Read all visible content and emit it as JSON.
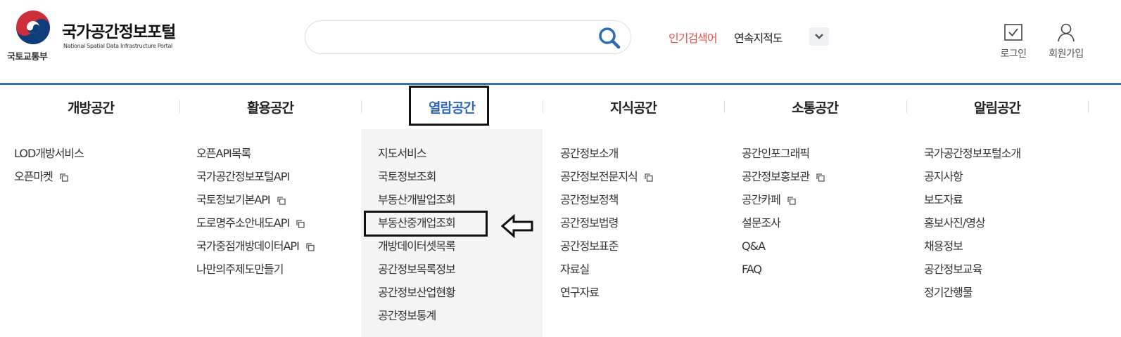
{
  "brand": {
    "ministry": "국토교통부",
    "title": "국가공간정보포털",
    "subtitle": "National Spatial Data Infrastructure Portal"
  },
  "search": {
    "placeholder": "",
    "value": ""
  },
  "popular": {
    "label": "인기검색어",
    "term": "연속지적도"
  },
  "util": {
    "login": "로그인",
    "join": "회원가입"
  },
  "colors": {
    "accent": "#2f68b7",
    "topline": "#3d6fb0",
    "popular": "#e8524f",
    "active_bg": "#f4f4f4"
  },
  "gnb": [
    {
      "label": "개방공간"
    },
    {
      "label": "활용공간"
    },
    {
      "label": "열람공간"
    },
    {
      "label": "지식공간"
    },
    {
      "label": "소통공간"
    },
    {
      "label": "알림공간"
    }
  ],
  "submenus": [
    [
      {
        "label": "LOD개방서비스"
      },
      {
        "label": "오픈마켓",
        "icon": "external-link-icon"
      }
    ],
    [
      {
        "label": "오픈API목록"
      },
      {
        "label": "국가공간정보포털API"
      },
      {
        "label": "국토정보기본API",
        "icon": "external-link-icon"
      },
      {
        "label": "도로명주소안내도API",
        "icon": "external-link-icon"
      },
      {
        "label": "국가중점개방데이터API",
        "icon": "external-link-icon"
      },
      {
        "label": "나만의주제도만들기"
      }
    ],
    [
      {
        "label": "지도서비스"
      },
      {
        "label": "국토정보조회"
      },
      {
        "label": "부동산개발업조회"
      },
      {
        "label": "부동산중개업조회"
      },
      {
        "label": "개방데이터셋목록"
      },
      {
        "label": "공간정보목록정보"
      },
      {
        "label": "공간정보산업현황"
      },
      {
        "label": "공간정보통계"
      }
    ],
    [
      {
        "label": "공간정보소개"
      },
      {
        "label": "공간정보전문지식",
        "icon": "external-link-icon"
      },
      {
        "label": "공간정보정책"
      },
      {
        "label": "공간정보법령"
      },
      {
        "label": "공간정보표준"
      },
      {
        "label": "자료실"
      },
      {
        "label": "연구자료"
      }
    ],
    [
      {
        "label": "공간인포그래픽"
      },
      {
        "label": "공간정보홍보관",
        "icon": "external-link-icon"
      },
      {
        "label": "공간카페",
        "icon": "external-link-icon"
      },
      {
        "label": "설문조사"
      },
      {
        "label": "Q&A"
      },
      {
        "label": "FAQ"
      }
    ],
    [
      {
        "label": "국가공간정보포털소개"
      },
      {
        "label": "공지사항"
      },
      {
        "label": "보도자료"
      },
      {
        "label": "홍보사진/영상"
      },
      {
        "label": "채용정보"
      },
      {
        "label": "공간정보교육"
      },
      {
        "label": "정기간행물"
      }
    ]
  ]
}
